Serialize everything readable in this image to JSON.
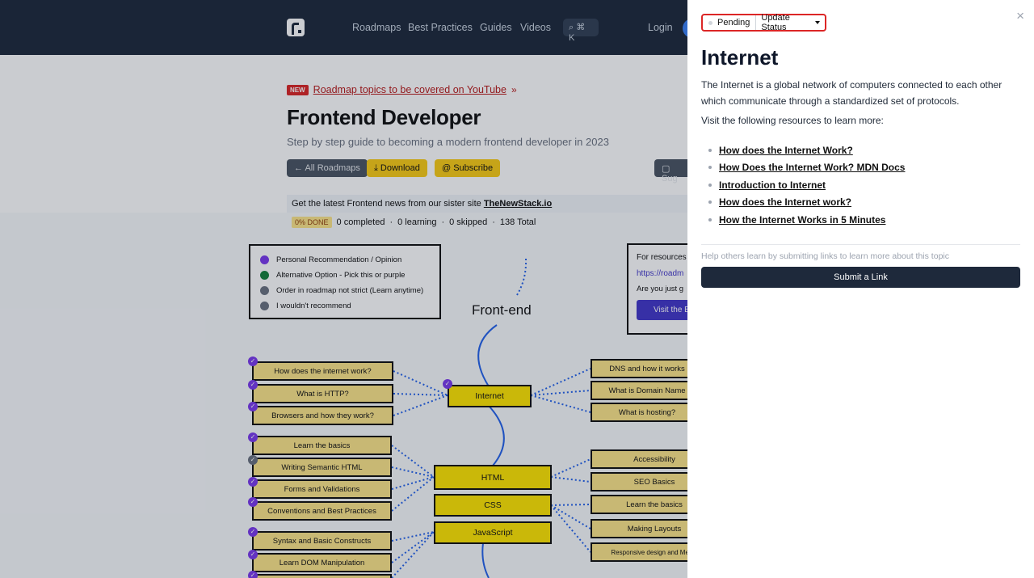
{
  "nav": {
    "links": [
      "Roadmaps",
      "Best Practices",
      "Guides",
      "Videos"
    ],
    "search": "⌘ K",
    "login": "Login"
  },
  "hero": {
    "new_badge": "NEW",
    "new_link": "Roadmap topics to be covered on YouTube",
    "new_arrow": "»",
    "title": "Frontend Developer",
    "subtitle": "Step by step guide to becoming a modern frontend developer in 2023",
    "btn_all": "← All Roadmaps",
    "btn_download": "⤓  Download",
    "btn_subscribe": "@  Subscribe",
    "btn_suggest": "Sug",
    "news_text": "Get the latest Frontend news from our sister site ",
    "news_link": "TheNewStack.io",
    "progress": {
      "done": "0% DONE",
      "completed": "0 completed",
      "learning": "0 learning",
      "skipped": "0 skipped",
      "total": "138 Total",
      "sep": "·"
    }
  },
  "legend": [
    {
      "label": "Personal Recommendation / Opinion",
      "color": "#7c3aed"
    },
    {
      "label": "Alternative Option - Pick this or purple",
      "color": "#15803d"
    },
    {
      "label": "Order in roadmap not strict (Learn anytime)",
      "color": "#6b7280"
    },
    {
      "label": "I wouldn't recommend",
      "color": "#6b7280"
    }
  ],
  "resource_box": {
    "title": "For resources",
    "link": "https://roadm",
    "question": "Are you just g",
    "button": "Visit the B"
  },
  "roadmap": {
    "root": "Front-end",
    "main_nodes": [
      "Internet",
      "HTML",
      "CSS",
      "JavaScript"
    ],
    "left_nodes": [
      "How does the internet work?",
      "What is HTTP?",
      "Browsers and how they work?",
      "Learn the basics",
      "Writing Semantic HTML",
      "Forms and Validations",
      "Conventions and Best Practices",
      "Syntax and Basic Constructs",
      "Learn DOM Manipulation"
    ],
    "right_nodes": [
      "DNS and how it works",
      "What is Domain Name",
      "What is hosting?",
      "Accessibility",
      "SEO Basics",
      "Learn the basics",
      "Making Layouts",
      "Responsive design and Media"
    ]
  },
  "drawer": {
    "status": "Pending",
    "update": "Update Status",
    "close": "×",
    "title": "Internet",
    "description": "The Internet is a global network of computers connected to each other which communicate through a standardized set of protocols.",
    "visit": "Visit the following resources to learn more:",
    "resources": [
      "How does the Internet Work?",
      "How Does the Internet Work? MDN Docs",
      "Introduction to Internet",
      "How does the Internet work?",
      "How the Internet Works in 5 Minutes"
    ],
    "help": "Help others learn by submitting links to learn more about this topic",
    "submit": "Submit a Link"
  }
}
